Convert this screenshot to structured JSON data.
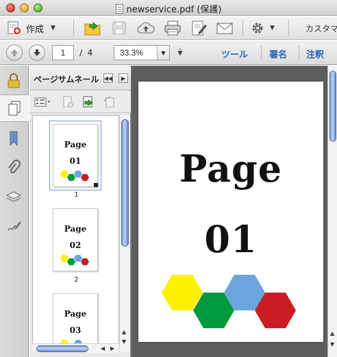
{
  "window": {
    "title": "newservice.pdf (保護)"
  },
  "toolbar": {
    "create_label": "作成",
    "customize_label": "カスタマイズ"
  },
  "nav": {
    "current_page": "1",
    "page_separator": "/",
    "total_pages": "4",
    "zoom": "33.3%",
    "tools_link": "ツール",
    "sign_link": "署名",
    "comment_link": "注釈"
  },
  "panel": {
    "title": "ページサムネール",
    "thumbnails": [
      {
        "word": "Page",
        "number": "01",
        "label": "1"
      },
      {
        "word": "Page",
        "number": "02",
        "label": "2"
      },
      {
        "word": "Page",
        "number": "03",
        "label": ""
      }
    ]
  },
  "document": {
    "page_word": "Page",
    "page_number": "01"
  },
  "colors": {
    "hex_yellow": "#fff200",
    "hex_green": "#009a3e",
    "hex_blue": "#6aa6dc",
    "hex_red": "#c81e23",
    "accent_link": "#2a64b4"
  },
  "icons": {
    "rail": [
      "lock-icon",
      "pages-icon",
      "bookmark-icon",
      "attachment-icon",
      "layers-icon",
      "signature-icon"
    ],
    "toolbar": [
      "create-icon",
      "open-icon",
      "save-icon",
      "upload-icon",
      "print-icon",
      "edit-icon",
      "email-icon",
      "gear-icon"
    ]
  }
}
